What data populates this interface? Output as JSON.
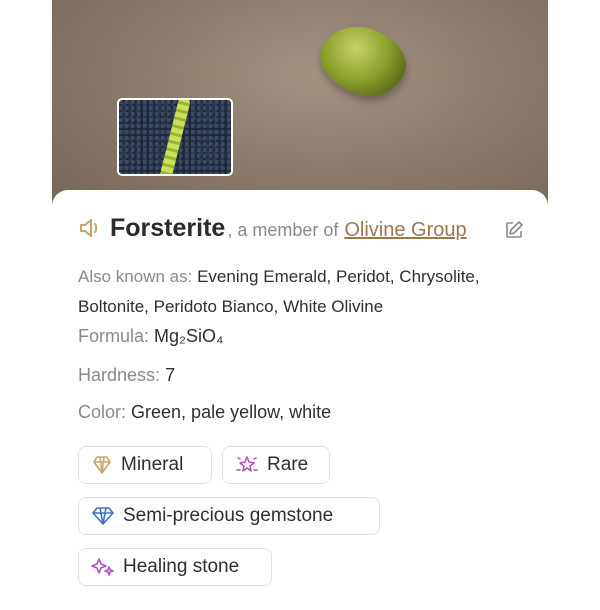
{
  "mineral": {
    "name": "Forsterite",
    "member_text": ", a member of",
    "group": "Olivine Group"
  },
  "details": {
    "aka_label": "Also known as:",
    "aka_value": "Evening Emerald, Peridot, Chrysolite, Boltonite, Peridoto Bianco, White Olivine",
    "formula_label": "Formula:",
    "formula_value": "Mg₂SiO₄",
    "hardness_label": "Hardness:",
    "hardness_value": "7",
    "color_label": "Color:",
    "color_value": "Green, pale yellow, white"
  },
  "tags": [
    {
      "label": "Mineral",
      "icon": "crystal-icon"
    },
    {
      "label": "Rare",
      "icon": "sparkle-icon"
    },
    {
      "label": "Semi-precious gemstone",
      "icon": "diamond-icon"
    },
    {
      "label": "Healing stone",
      "icon": "sparkles-icon"
    }
  ],
  "colors": {
    "accent": "#9a7a4a",
    "gem_blue": "#3f72b8",
    "purple": "#b04fc4"
  }
}
